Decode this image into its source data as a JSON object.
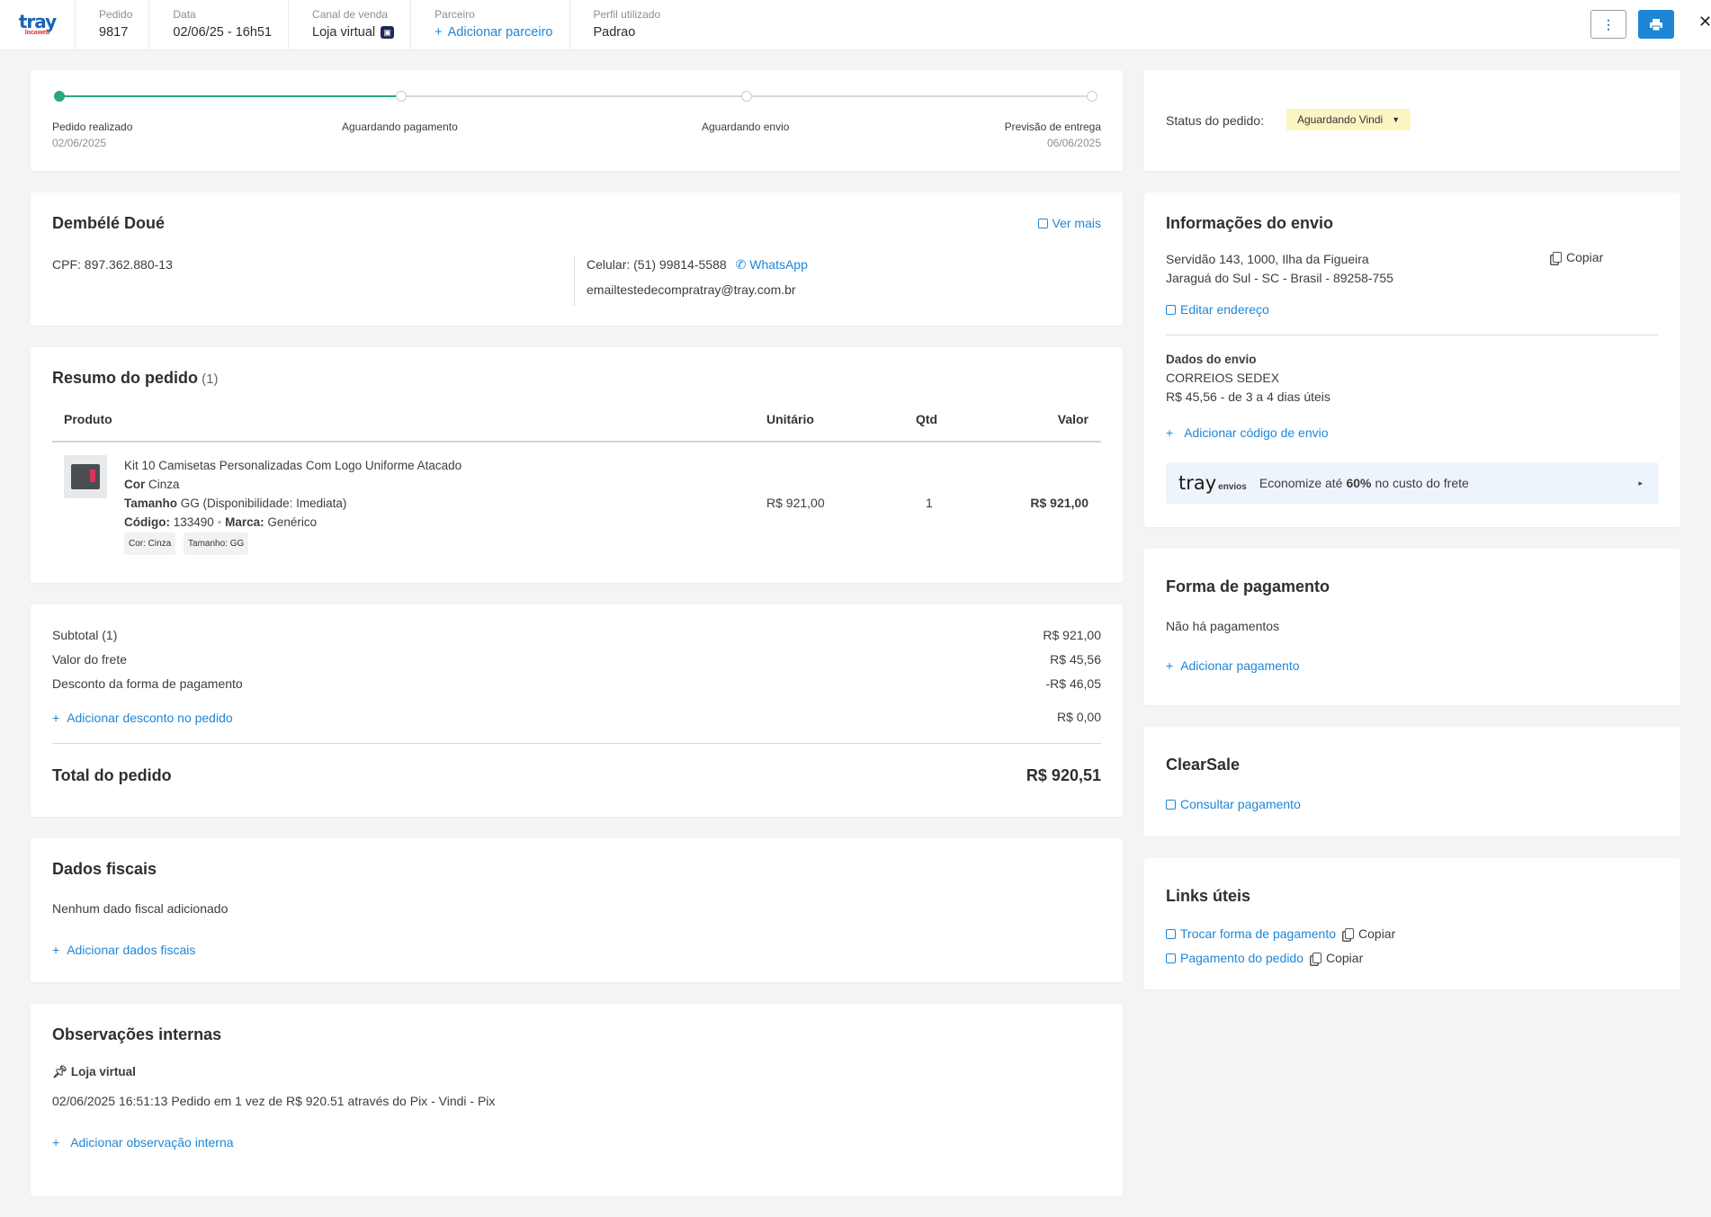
{
  "header": {
    "brand": "tray",
    "brand_sub": "locaweb",
    "pedido": {
      "label": "Pedido",
      "value": "9817"
    },
    "data": {
      "label": "Data",
      "value": "02/06/25 - 16h51"
    },
    "canal": {
      "label": "Canal de venda",
      "value": "Loja virtual"
    },
    "parceiro": {
      "label": "Parceiro",
      "value": "Adicionar parceiro"
    },
    "perfil": {
      "label": "Perfil utilizado",
      "value": "Padrao"
    }
  },
  "progress": {
    "steps": [
      {
        "label": "Pedido realizado",
        "date": "02/06/2025",
        "done": true
      },
      {
        "label": "Aguardando pagamento",
        "date": "",
        "done": false
      },
      {
        "label": "Aguardando envio",
        "date": "",
        "done": false
      },
      {
        "label": "Previsão de entrega",
        "date": "06/06/2025",
        "done": false
      }
    ]
  },
  "status": {
    "label": "Status do pedido:",
    "value": "Aguardando Vindi"
  },
  "customer": {
    "name": "Dembélé Doué",
    "ver_mais": "Ver mais",
    "cpf": "CPF: 897.362.880-13",
    "celular": "Celular: (51) 99814-5588",
    "whatsapp": "WhatsApp",
    "email": "emailtestedecompratray@tray.com.br"
  },
  "resumo": {
    "title": "Resumo do pedido",
    "count": "(1)",
    "columns": {
      "produto": "Produto",
      "unitario": "Unitário",
      "qtd": "Qtd",
      "valor": "Valor"
    },
    "item": {
      "name": "Kit 10 Camisetas Personalizadas Com Logo Uniforme Atacado",
      "cor_label": "Cor",
      "cor": "Cinza",
      "tamanho_label": "Tamanho",
      "tamanho": "GG (Disponibilidade: Imediata)",
      "codigo_label": "Código:",
      "codigo": "133490",
      "marca_label": "Marca:",
      "marca": "Genérico",
      "tags": [
        "Cor: Cinza",
        "Tamanho: GG"
      ],
      "unitario": "R$ 921,00",
      "qtd": "1",
      "valor": "R$ 921,00"
    }
  },
  "totals": {
    "subtotal_label": "Subtotal (1)",
    "subtotal": "R$ 921,00",
    "frete_label": "Valor do frete",
    "frete": "R$ 45,56",
    "desconto_label": "Desconto da forma de pagamento",
    "desconto": "-R$ 46,05",
    "add_desconto": "Adicionar desconto no pedido",
    "add_desconto_value": "R$ 0,00",
    "total_label": "Total do pedido",
    "total": "R$ 920,51"
  },
  "fiscal": {
    "title": "Dados fiscais",
    "empty": "Nenhum dado fiscal adicionado",
    "add": "Adicionar dados fiscais"
  },
  "obs": {
    "title": "Observações internas",
    "source": "Loja virtual",
    "text": "02/06/2025 16:51:13 Pedido em 1 vez de R$ 920.51 através do Pix - Vindi - Pix",
    "add": "Adicionar observação interna"
  },
  "envio": {
    "title": "Informações do envio",
    "address1": "Servidão 143, 1000, Ilha da Figueira",
    "address2": "Jaraguá do Sul - SC - Brasil - 89258-755",
    "copiar": "Copiar",
    "editar": "Editar endereço",
    "dados_title": "Dados do envio",
    "carrier": "CORREIOS SEDEX",
    "price": "R$ 45,56 - de 3 a 4 dias úteis",
    "add_codigo": "Adicionar código de envio",
    "banner": {
      "brand": "tray",
      "brand_sub": "envios",
      "text_pre": "Economize até ",
      "text_bold": "60%",
      "text_post": " no custo do frete"
    }
  },
  "pagamento": {
    "title": "Forma de pagamento",
    "empty": "Não há pagamentos",
    "add": "Adicionar pagamento"
  },
  "clearsale": {
    "title": "ClearSale",
    "consultar": "Consultar pagamento"
  },
  "links": {
    "title": "Links úteis",
    "items": [
      {
        "label": "Trocar forma de pagamento",
        "copy": "Copiar"
      },
      {
        "label": "Pagamento do pedido",
        "copy": "Copiar"
      }
    ]
  },
  "colors": {
    "accent": "#1f86d6",
    "success": "#2aa87a",
    "status_bg": "#fbf5c4"
  }
}
